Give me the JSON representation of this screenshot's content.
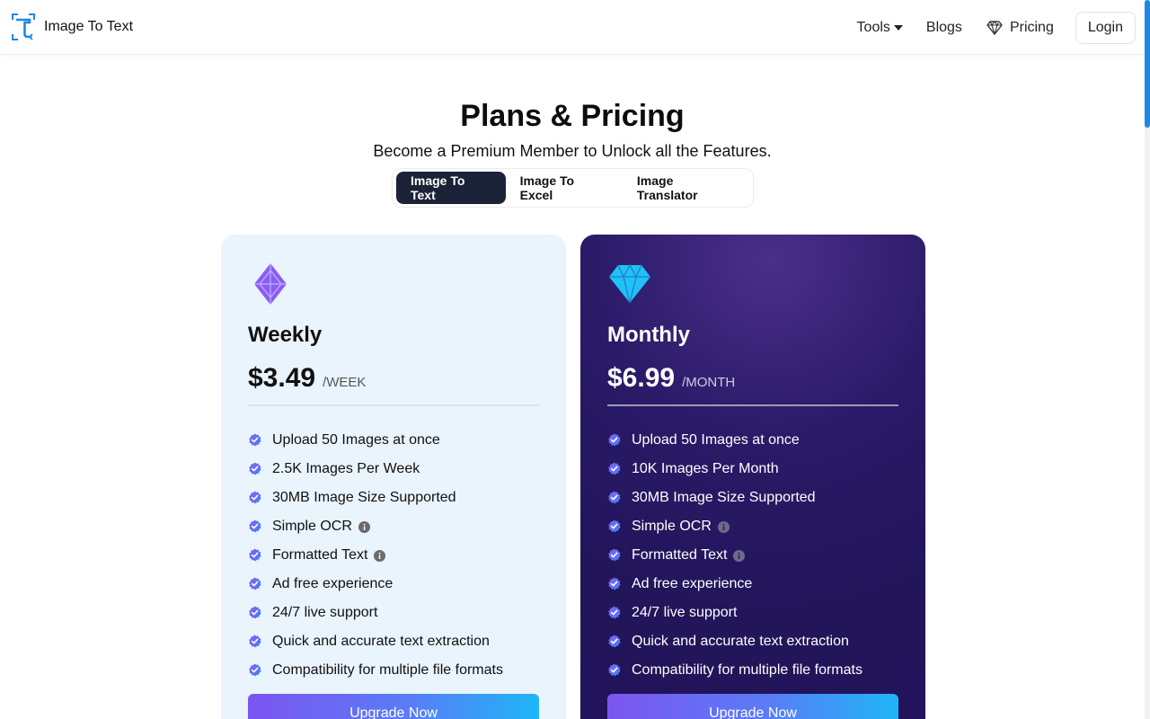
{
  "header": {
    "logo_text": "Image To Text",
    "nav": {
      "tools": "Tools",
      "blogs": "Blogs",
      "pricing": "Pricing",
      "login": "Login"
    }
  },
  "hero": {
    "title": "Plans & Pricing",
    "subtitle": "Become a Premium Member to Unlock all the Features."
  },
  "tabs": [
    {
      "label": "Image To Text",
      "active": true
    },
    {
      "label": "Image To Excel",
      "active": false
    },
    {
      "label": "Image Translator",
      "active": false
    }
  ],
  "plans": {
    "weekly": {
      "icon": "purple-gem-icon",
      "name": "Weekly",
      "price": "$3.49",
      "period": "/WEEK",
      "features": [
        "Upload 50 Images at once",
        "2.5K Images Per Week",
        "30MB Image Size Supported",
        "Simple OCR",
        "Formatted Text",
        "Ad free experience",
        "24/7 live support",
        "Quick and accurate text extraction",
        "Compatibility for multiple file formats"
      ],
      "button": "Upgrade Now"
    },
    "monthly": {
      "icon": "blue-diamond-icon",
      "name": "Monthly",
      "price": "$6.99",
      "period": "/MONTH",
      "features": [
        "Upload 50 Images at once",
        "10K Images Per Month",
        "30MB Image Size Supported",
        "Simple OCR",
        "Formatted Text",
        "Ad free experience",
        "24/7 live support",
        "Quick and accurate text extraction",
        "Compatibility for multiple file formats"
      ],
      "button": "Upgrade Now"
    }
  },
  "colors": {
    "accent_dark": "#1c2237",
    "weekly_bg": "#eaf4fd",
    "monthly_bg": "#22155a",
    "brand_blue": "#1e88e5"
  }
}
